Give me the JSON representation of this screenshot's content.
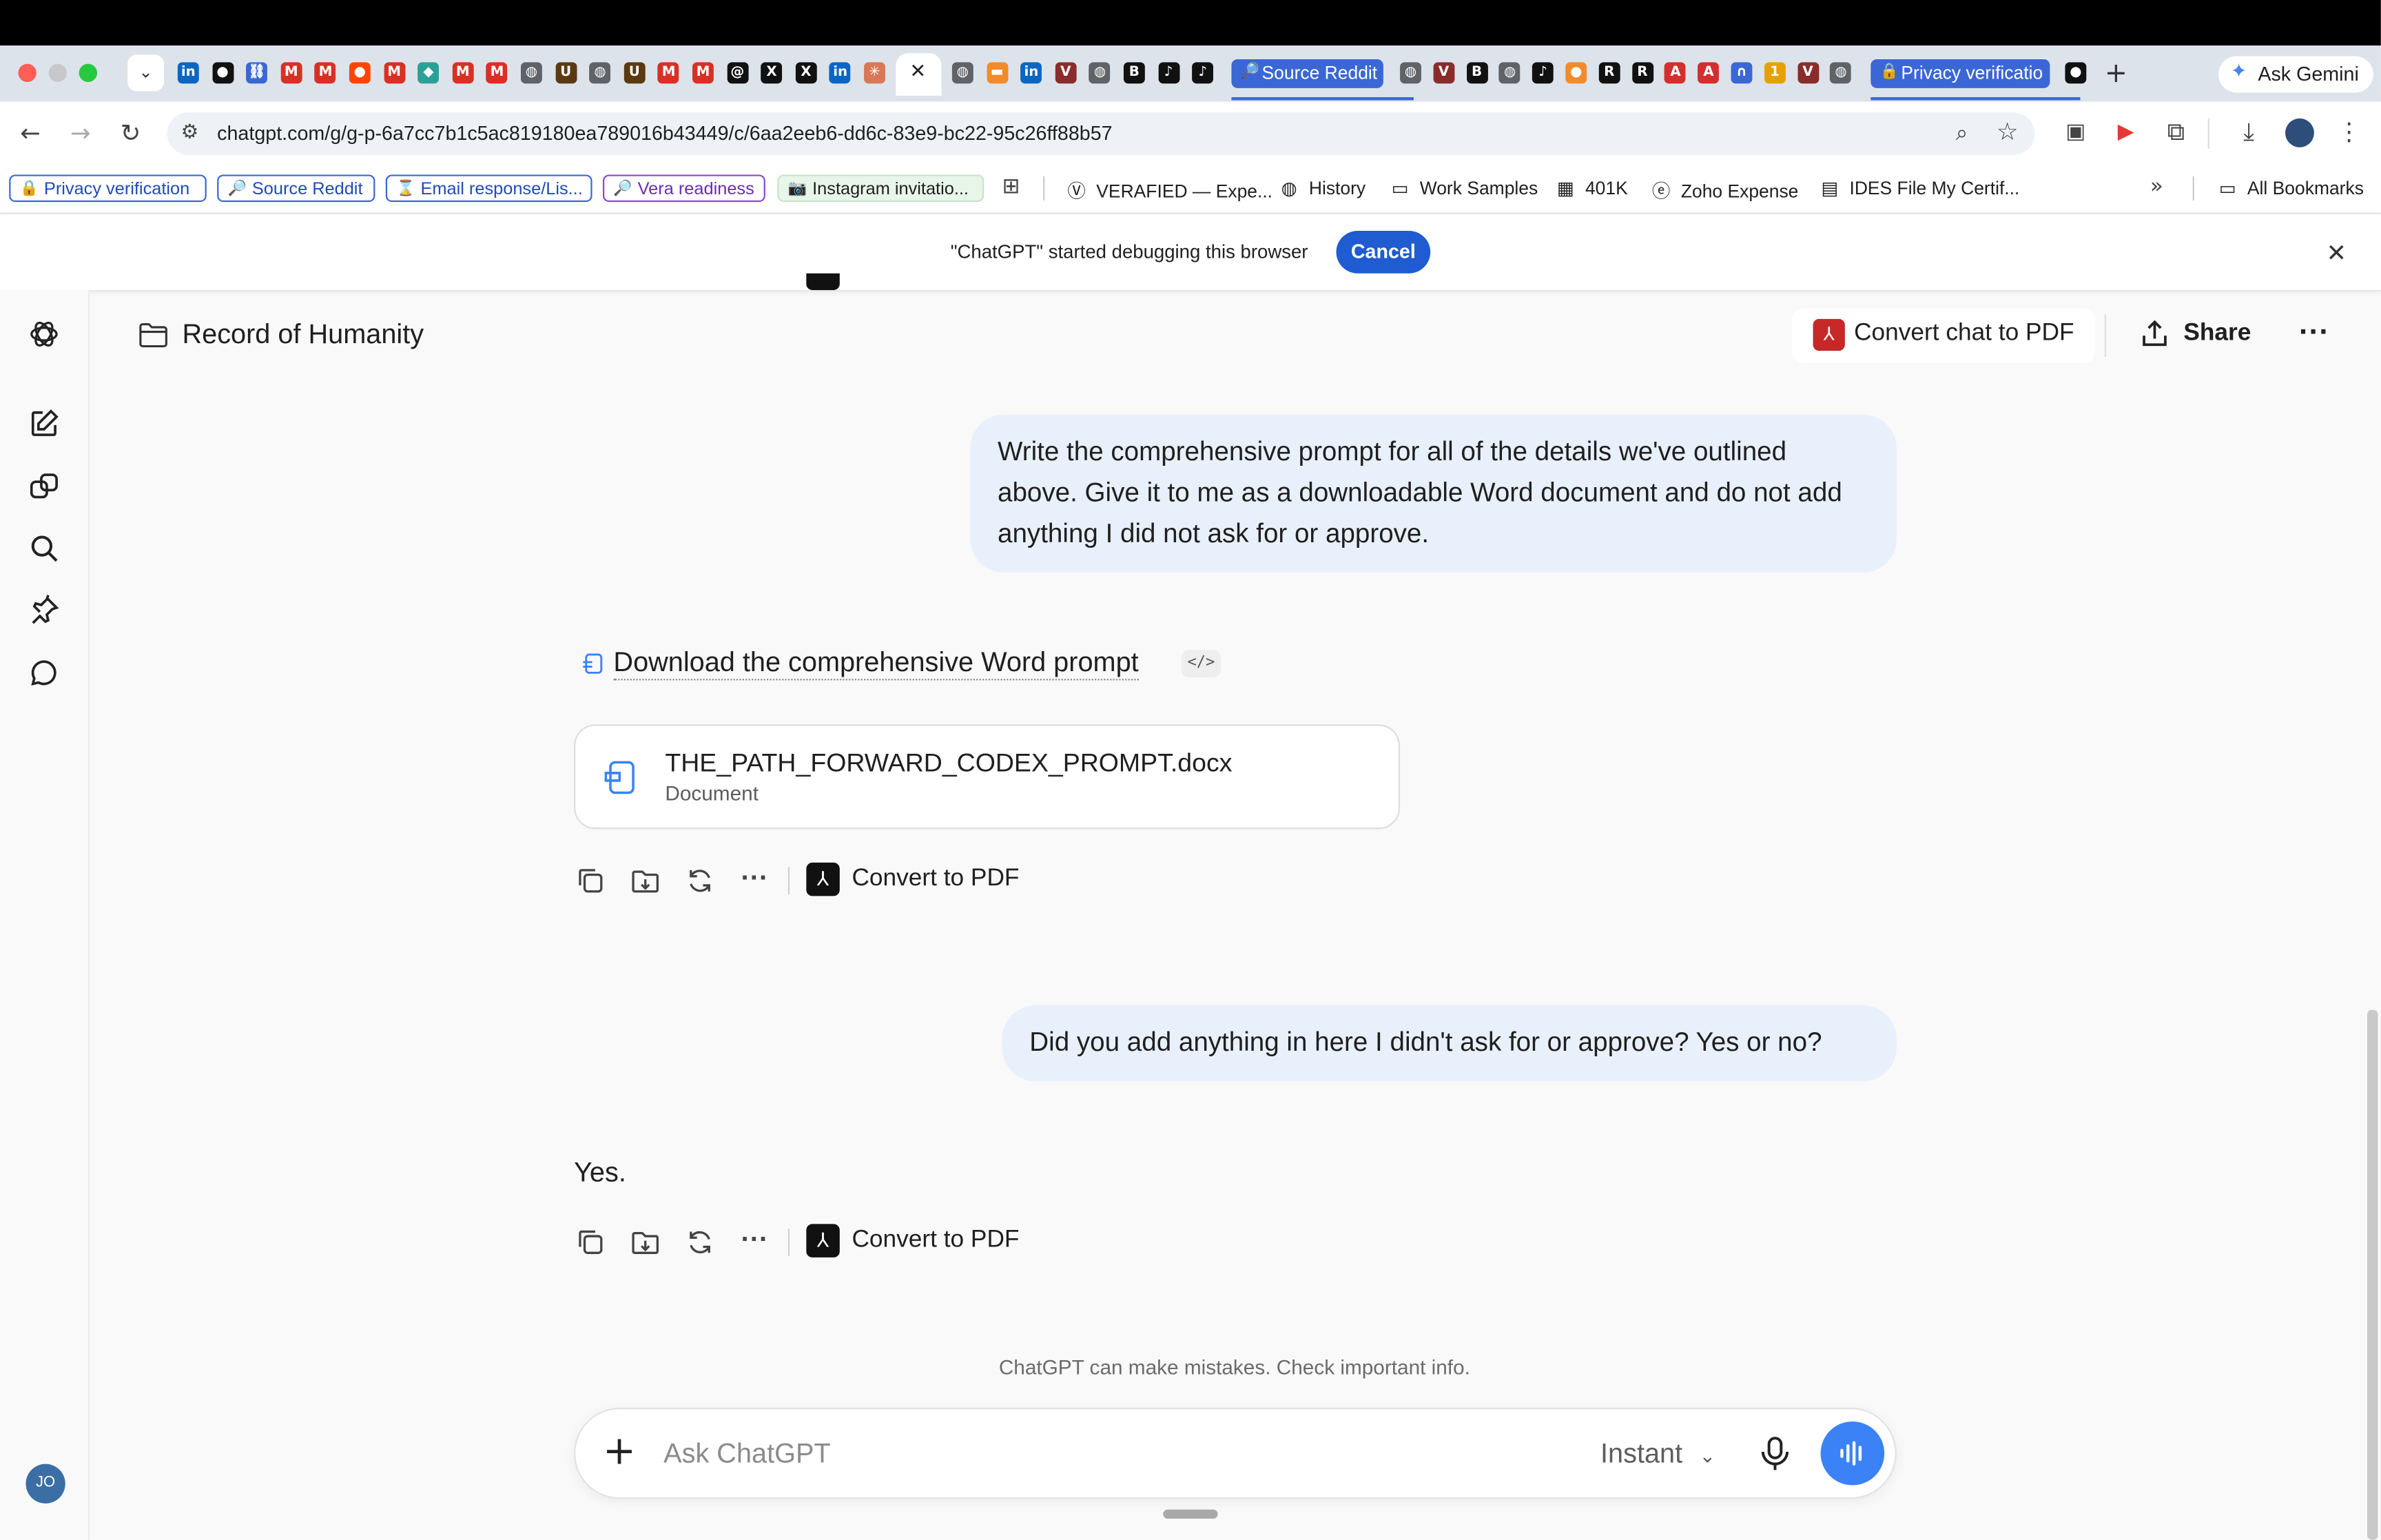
{
  "browser": {
    "tabs_pinned": [
      {
        "icon": "linkedin-icon",
        "color": "#0a66c2",
        "glyph": "in"
      },
      {
        "icon": "circle-dark-icon",
        "color": "#111111",
        "glyph": "●"
      },
      {
        "icon": "link-icon",
        "color": "#3b67d6",
        "glyph": "⛓"
      },
      {
        "icon": "gmail-icon",
        "color": "#d93025",
        "glyph": "M"
      },
      {
        "icon": "gmail-icon",
        "color": "#d93025",
        "glyph": "M"
      },
      {
        "icon": "reddit-icon",
        "color": "#ff4500",
        "glyph": "●"
      },
      {
        "icon": "gmail-icon",
        "color": "#d93025",
        "glyph": "M"
      },
      {
        "icon": "diamond-icon",
        "color": "#2aa198",
        "glyph": "◆"
      },
      {
        "icon": "gmail-icon",
        "color": "#d93025",
        "glyph": "M"
      },
      {
        "icon": "gmail-icon",
        "color": "#d93025",
        "glyph": "M"
      },
      {
        "icon": "globe-icon",
        "color": "#5f6368",
        "glyph": "◍"
      },
      {
        "icon": "ups-icon",
        "color": "#5b3a12",
        "glyph": "U"
      },
      {
        "icon": "globe-icon",
        "color": "#5f6368",
        "glyph": "◍"
      },
      {
        "icon": "ups-icon",
        "color": "#5b3a12",
        "glyph": "U"
      },
      {
        "icon": "gmail-icon",
        "color": "#d93025",
        "glyph": "M"
      },
      {
        "icon": "gmail-icon",
        "color": "#d93025",
        "glyph": "M"
      },
      {
        "icon": "threads-icon",
        "color": "#111111",
        "glyph": "@"
      },
      {
        "icon": "x-icon",
        "color": "#111111",
        "glyph": "X"
      },
      {
        "icon": "x-icon",
        "color": "#111111",
        "glyph": "X"
      },
      {
        "icon": "linkedin-icon",
        "color": "#0a66c2",
        "glyph": "in"
      },
      {
        "icon": "claude-icon",
        "color": "#d97757",
        "glyph": "✳"
      }
    ],
    "tabs_right": [
      {
        "icon": "globe-icon",
        "color": "#5f6368",
        "glyph": "◍"
      },
      {
        "icon": "orange-icon",
        "color": "#f28b2c",
        "glyph": "▬"
      },
      {
        "icon": "linkedin-icon",
        "color": "#0a66c2",
        "glyph": "in"
      },
      {
        "icon": "v-icon",
        "color": "#8a2c2c",
        "glyph": "V"
      },
      {
        "icon": "globe-icon",
        "color": "#5f6368",
        "glyph": "◍"
      },
      {
        "icon": "bs-icon",
        "color": "#111111",
        "glyph": "B"
      },
      {
        "icon": "tiktok-icon",
        "color": "#111111",
        "glyph": "♪"
      },
      {
        "icon": "tiktok-icon",
        "color": "#111111",
        "glyph": "♪"
      }
    ],
    "tab_source_reddit": "Source Reddit",
    "tabs_mid": [
      {
        "icon": "globe-icon",
        "color": "#5f6368",
        "glyph": "◍"
      },
      {
        "icon": "v-icon",
        "color": "#8a2c2c",
        "glyph": "V"
      },
      {
        "icon": "bs-icon",
        "color": "#111111",
        "glyph": "B"
      },
      {
        "icon": "globe-icon",
        "color": "#5f6368",
        "glyph": "◍"
      },
      {
        "icon": "tiktok-icon",
        "color": "#111111",
        "glyph": "♪"
      },
      {
        "icon": "orange-icon",
        "color": "#f28b2c",
        "glyph": "●"
      },
      {
        "icon": "r-icon",
        "color": "#111111",
        "glyph": "R"
      },
      {
        "icon": "r-icon",
        "color": "#111111",
        "glyph": "R"
      },
      {
        "icon": "adobe-icon",
        "color": "#d32f2f",
        "glyph": "A"
      },
      {
        "icon": "adobe-icon",
        "color": "#d32f2f",
        "glyph": "A"
      },
      {
        "icon": "arc-icon",
        "color": "#3b67d6",
        "glyph": "∩"
      },
      {
        "icon": "one-icon",
        "color": "#e6a100",
        "glyph": "1"
      },
      {
        "icon": "v-icon",
        "color": "#8a2c2c",
        "glyph": "V"
      },
      {
        "icon": "globe-icon",
        "color": "#5f6368",
        "glyph": "◍"
      }
    ],
    "tab_privacy": "Privacy verificatio",
    "ask_gemini": "Ask Gemini",
    "url": "chatgpt.com/g/g-p-6a7cc7b1c5ac819180ea789016b43449/c/6aa2eeb6-dd6c-83e9-bc22-95c26ff88b57",
    "bookmark_pills": [
      {
        "label": "Privacy verification",
        "style": "blue",
        "glyph": "🔒"
      },
      {
        "label": "Source Reddit",
        "style": "blue",
        "glyph": "🔎"
      },
      {
        "label": "Email response/Lis...",
        "style": "blue",
        "glyph": "⌛"
      },
      {
        "label": "Vera readiness",
        "style": "purple",
        "glyph": "🔎"
      },
      {
        "label": "Instagram invitatio...",
        "style": "green",
        "glyph": "📷"
      }
    ],
    "bookmarks": [
      {
        "label": "VERAFIED — Expe...",
        "glyph": "Ⓥ"
      },
      {
        "label": "History",
        "glyph": "◍"
      },
      {
        "label": "Work Samples",
        "glyph": "▭"
      },
      {
        "label": "401K",
        "glyph": "▦"
      },
      {
        "label": "Zoho Expense",
        "glyph": "ⓔ"
      },
      {
        "label": "IDES File My Certif...",
        "glyph": "▤"
      }
    ],
    "all_bookmarks": "All Bookmarks",
    "debug_message": "\"ChatGPT\" started debugging this browser",
    "debug_cancel": "Cancel"
  },
  "header": {
    "project_title": "Record of Humanity",
    "convert_chat": "Convert chat to PDF",
    "share": "Share"
  },
  "messages": {
    "user1": "Write the comprehensive prompt for all of the details we've outlined above. Give it to me as a downloadable Word document and do not add anything I did not ask for or approve.",
    "download_link": "Download the comprehensive Word prompt",
    "code_badge": "</>",
    "file_name": "THE_PATH_FORWARD_CODEX_PROMPT.docx",
    "file_type": "Document",
    "convert_pdf": "Convert to PDF",
    "user2": "Did you add anything in here I didn't ask for or approve? Yes or no?",
    "assistant2": "Yes."
  },
  "footer": {
    "disclaimer": "ChatGPT can make mistakes. Check important info.",
    "composer_placeholder": "Ask ChatGPT",
    "mode": "Instant"
  },
  "user": {
    "initials": "JO"
  },
  "colors": {
    "accent": "#1f5bd1",
    "bubble": "#e8f0fb",
    "voice": "#3b82f6"
  }
}
